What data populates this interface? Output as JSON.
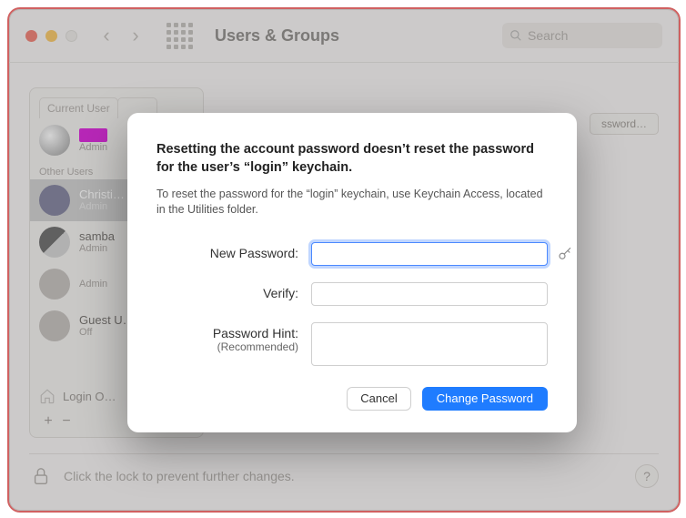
{
  "toolbar": {
    "title": "Users & Groups",
    "search_placeholder": "Search"
  },
  "sidebar": {
    "tab_current": "Current User",
    "section_other": "Other Users",
    "users": [
      {
        "name_redacted": true,
        "sub": "Admin"
      },
      {
        "name": "Christi…",
        "sub": "Admin",
        "selected": true
      },
      {
        "name": "samba",
        "sub": "Admin"
      },
      {
        "name": "",
        "sub": "Admin"
      },
      {
        "name": "Guest U…",
        "sub": "Off"
      }
    ],
    "login_options": "Login O…"
  },
  "mainpane": {
    "change_pw_btn": "ssword…"
  },
  "footer": {
    "lock_text": "Click the lock to prevent further changes.",
    "help": "?"
  },
  "modal": {
    "title": "Resetting the account password doesn’t reset the password for the user’s “login” keychain.",
    "subtitle": "To reset the password for the “login” keychain, use Keychain Access, located in the Utilities folder.",
    "label_new": "New Password:",
    "label_verify": "Verify:",
    "label_hint": "Password Hint:",
    "label_hint_sub": "(Recommended)",
    "cancel": "Cancel",
    "change": "Change Password"
  }
}
